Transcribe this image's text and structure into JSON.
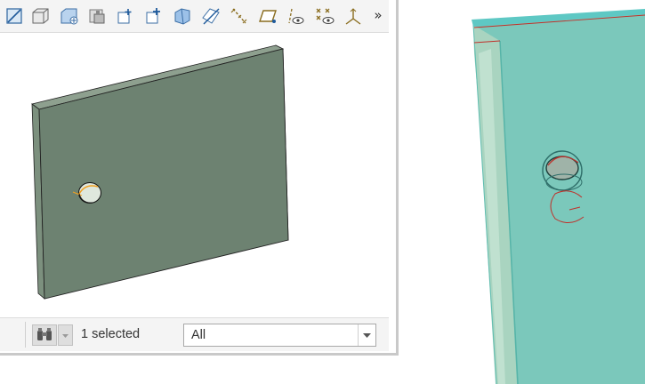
{
  "toolbar": {
    "buttons": [
      {
        "icon": "sketch-view-icon"
      },
      {
        "icon": "box-extrude-icon"
      },
      {
        "icon": "shaded-box-icon"
      },
      {
        "icon": "saved-views-icon"
      },
      {
        "icon": "add-view-icon"
      },
      {
        "icon": "add-feature-icon"
      },
      {
        "icon": "render-icon"
      },
      {
        "icon": "plane-display-icon"
      },
      {
        "icon": "axis-display-icon"
      },
      {
        "icon": "datum-plane-icon"
      },
      {
        "icon": "point-visibility-icon"
      },
      {
        "icon": "point-display-icon"
      },
      {
        "icon": "csys-display-icon"
      }
    ],
    "more_label": "»"
  },
  "status": {
    "find_icon": "binoculars-icon",
    "selection_text": "1 selected",
    "filter_value": "All"
  },
  "colors": {
    "plate_face": "#6e8272",
    "plate_edge": "#8ea08f",
    "highlight_orange": "#f0a020",
    "bg_model_face": "#7dc8bb",
    "bg_model_edge": "#a7d2be",
    "red_curve": "#c0302a"
  }
}
